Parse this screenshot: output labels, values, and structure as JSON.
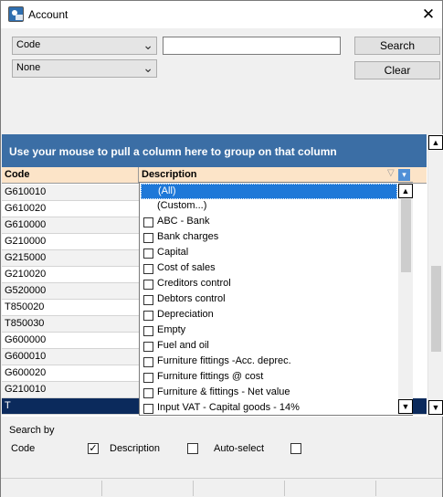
{
  "window": {
    "title": "Account",
    "close_glyph": "✕"
  },
  "search": {
    "field_select": "Code",
    "mode_select": "None",
    "input_value": "",
    "search_label": "Search",
    "clear_label": "Clear"
  },
  "grid": {
    "group_hint": "Use your mouse to pull a column here to group on that column",
    "columns": [
      "Code",
      "Description"
    ],
    "filter_indicator": "▽",
    "filter_button": "▾",
    "rows": [
      "G610010",
      "G610020",
      "G610000",
      "G210000",
      "G215000",
      "G210020",
      "G520000",
      "T850020",
      "T850030",
      "G600000",
      "G600010",
      "G600020",
      "G210010",
      "T"
    ],
    "scroll_up": "▲",
    "scroll_down": "▼"
  },
  "filter_dropdown": {
    "items": [
      "(All)",
      "(Custom...)",
      "ABC - Bank",
      "Bank charges",
      "Capital",
      "Cost of sales",
      "Creditors control",
      "Debtors control",
      "Depreciation",
      "Empty",
      "Fuel and oil",
      "Furniture  fittings -Acc. deprec.",
      "Furniture  fittings @ cost",
      "Furniture & fittings - Net value",
      "Input VAT - Capital goods - 14%"
    ],
    "scroll_up": "▲",
    "scroll_down": "▼"
  },
  "options": {
    "search_by_label": "Search by",
    "code_label": "Code",
    "code_checked": "✓",
    "description_label": "Description",
    "autoselect_label": "Auto-select"
  }
}
